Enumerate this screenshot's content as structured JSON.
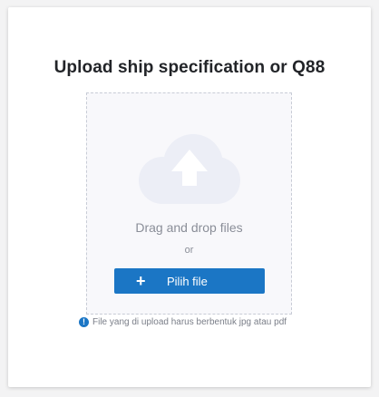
{
  "upload": {
    "title": "Upload ship specification or Q88",
    "drag_text": "Drag and drop files",
    "or_text": "or",
    "button_icon": "+",
    "button_label": "Pilih file",
    "note_icon": "!",
    "note_text": "File yang di upload harus berbentuk jpg atau pdf",
    "icon": "cloud-upload-icon"
  },
  "colors": {
    "accent": "#1b76c5",
    "cloud": "#eceef6",
    "arrow": "#ffffff"
  }
}
